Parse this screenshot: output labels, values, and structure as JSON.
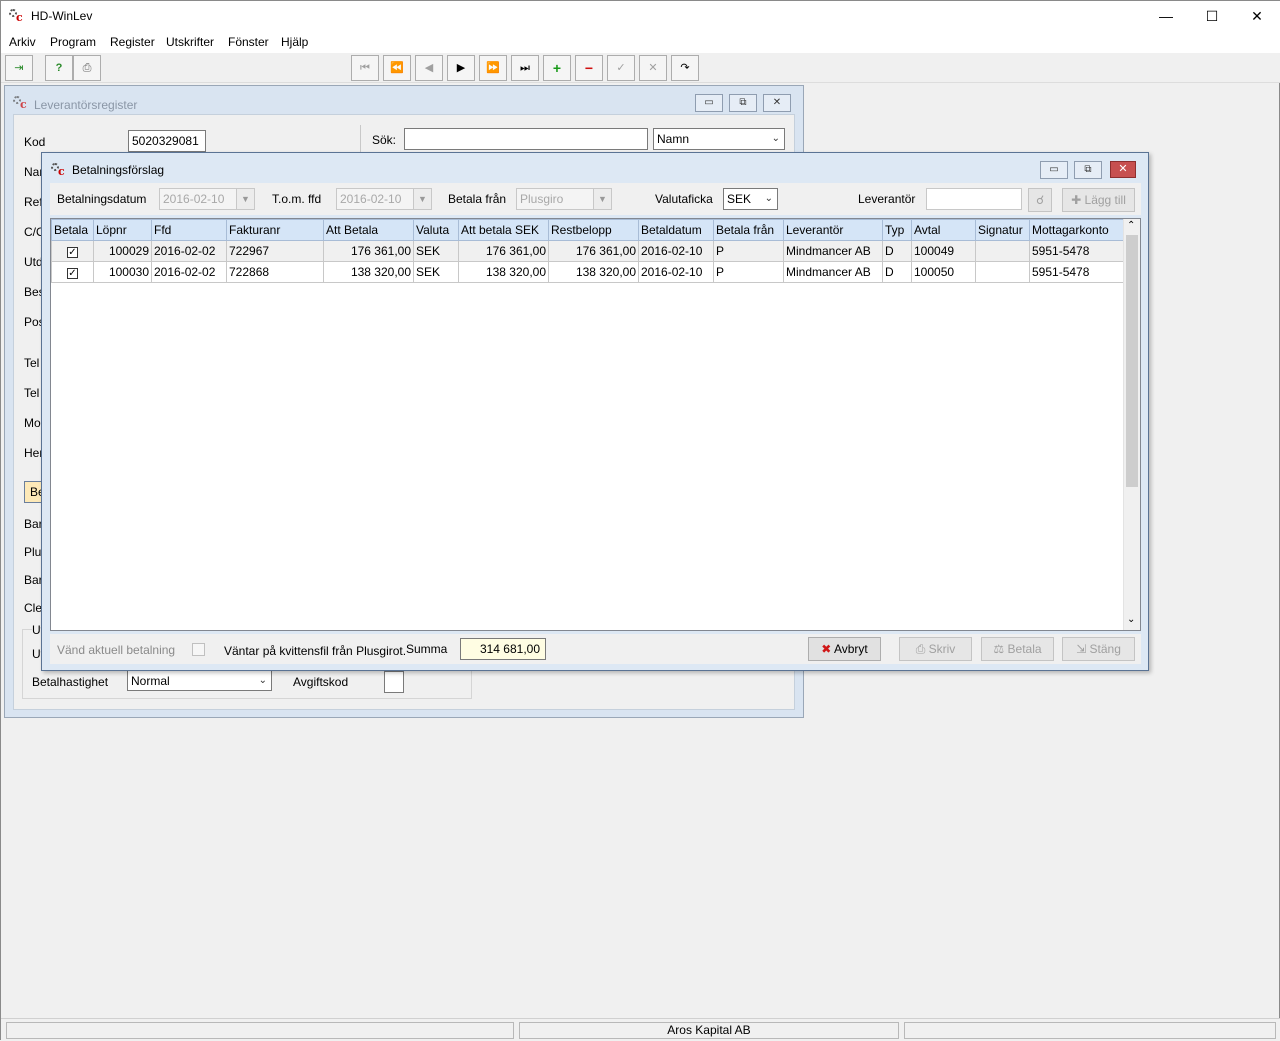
{
  "app": {
    "title": "HD-WinLev"
  },
  "menu": [
    "Arkiv",
    "Program",
    "Register",
    "Utskrifter",
    "Fönster",
    "Hjälp"
  ],
  "toolbar": {
    "nav_icons": [
      "first-icon",
      "prev-page-icon",
      "prev-icon",
      "next-icon",
      "next-page-icon",
      "last-icon",
      "add-icon",
      "remove-icon",
      "confirm-icon",
      "cancel-icon",
      "refresh-icon"
    ],
    "glyphs": {
      "first": "⏮",
      "prev_page": "⏪",
      "prev": "◀",
      "next": "▶",
      "next_page": "⏩",
      "last": "⏭",
      "add": "+",
      "remove": "−",
      "confirm": "✓",
      "cancel": "✕",
      "refresh": "↷"
    }
  },
  "supplier_register": {
    "title": "Leverantörsregister",
    "kod_label": "Kod",
    "kod_value": "5020329081",
    "search_label": "Sök:",
    "search_value": "",
    "search_by": "Namn",
    "side_labels": [
      "Nar",
      "Ref",
      "C/O",
      "Utd",
      "Bes",
      "Pos",
      "Tel",
      "Tel",
      "Mo",
      "Her",
      "Be",
      "Bar",
      "Plu",
      "Bar",
      "Cle",
      "Ut",
      "Ut"
    ],
    "betalhastighet_label": "Betalhastighet",
    "betalhastighet_value": "Normal",
    "avgiftskod_label": "Avgiftskod"
  },
  "payment_proposal": {
    "title": "Betalningsförslag",
    "filters": {
      "betalningsdatum_label": "Betalningsdatum",
      "betalningsdatum_value": "2016-02-10",
      "tom_ffd_label": "T.o.m. ffd",
      "tom_ffd_value": "2016-02-10",
      "betala_fran_label": "Betala från",
      "betala_fran_value": "Plusgiro",
      "valutaficka_label": "Valutaficka",
      "valutaficka_value": "SEK",
      "leverantor_label": "Leverantör",
      "leverantor_value": "",
      "lagg_till_label": "Lägg till"
    },
    "columns": [
      "Betala",
      "Löpnr",
      "Ffd",
      "Fakturanr",
      "Att Betala",
      "Valuta",
      "Att betala SEK",
      "Restbelopp",
      "Betaldatum",
      "Betala från",
      "Leverantör",
      "Typ",
      "Avtal",
      "Signatur",
      "Mottagarkonto"
    ],
    "rows": [
      {
        "betala": true,
        "lopnr": "100029",
        "ffd": "2016-02-02",
        "fakturanr": "722967",
        "att_betala": "176 361,00",
        "valuta": "SEK",
        "att_betala_sek": "176 361,00",
        "restbelopp": "176 361,00",
        "betaldatum": "2016-02-10",
        "betala_fran": "P",
        "leverantor": "Mindmancer AB",
        "typ": "D",
        "avtal": "100049",
        "signatur": "",
        "mottagarkonto": "5951-5478"
      },
      {
        "betala": true,
        "lopnr": "100030",
        "ffd": "2016-02-02",
        "fakturanr": "722868",
        "att_betala": "138 320,00",
        "valuta": "SEK",
        "att_betala_sek": "138 320,00",
        "restbelopp": "138 320,00",
        "betaldatum": "2016-02-10",
        "betala_fran": "P",
        "leverantor": "Mindmancer AB",
        "typ": "D",
        "avtal": "100050",
        "signatur": "",
        "mottagarkonto": "5951-5478"
      }
    ],
    "footer": {
      "vand_label": "Vänd aktuell betalning",
      "waiting_text": "Väntar på kvittensfil från Plusgirot.",
      "summa_label": "Summa",
      "summa_value": "314 681,00",
      "avbryt": "Avbryt",
      "skriv": "Skriv",
      "betala": "Betala",
      "stang": "Stäng"
    }
  },
  "status": {
    "company": "Aros Kapital AB"
  },
  "colors": {
    "grid_header": "#d5e5f7",
    "summa_bg": "#fffde3",
    "close_red": "#c75050",
    "logo_red": "#cc0000"
  }
}
